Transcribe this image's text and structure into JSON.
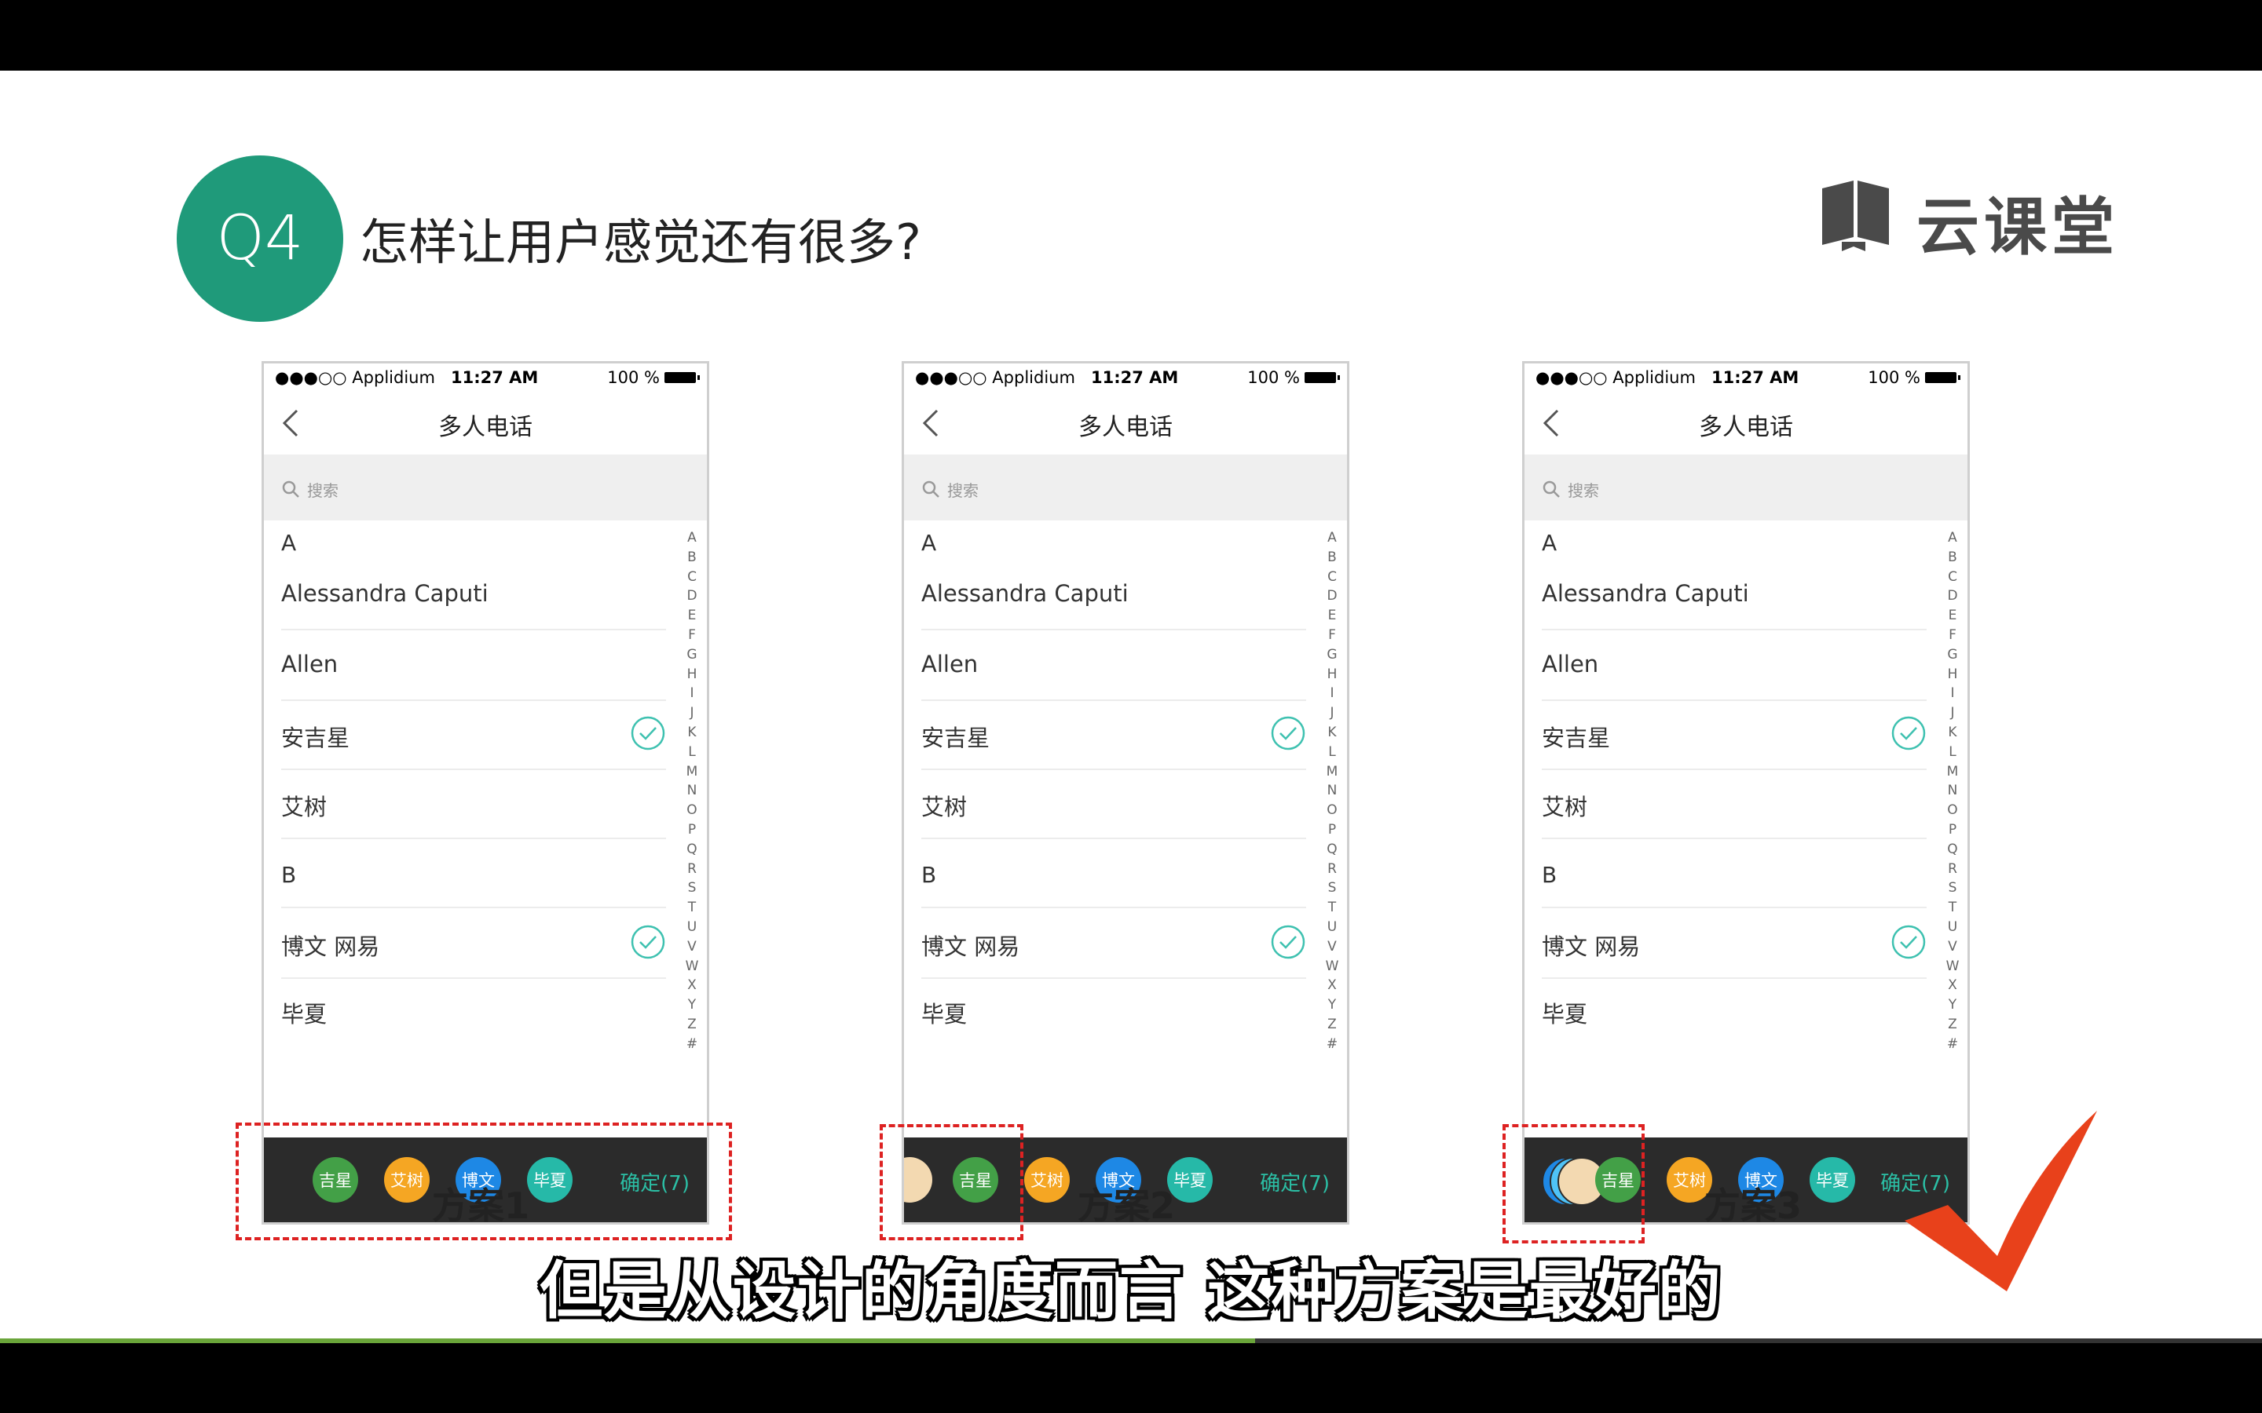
{
  "header": {
    "badge": "Q4",
    "title": "怎样让用户感觉还有很多?"
  },
  "logo": {
    "text": "云课堂"
  },
  "phone": {
    "status": {
      "carrier": "●●●○○ Applidium",
      "time": "11:27 AM",
      "battery": "100 %"
    },
    "nav_title": "多人电话",
    "search_placeholder": "搜索",
    "section_a": "A",
    "section_b": "B",
    "contacts": [
      {
        "name": "Alessandra Caputi",
        "checked": false
      },
      {
        "name": "Allen",
        "checked": false
      },
      {
        "name": "安吉星",
        "checked": true
      },
      {
        "name": "艾树",
        "checked": false
      },
      {
        "name": "博文 网易",
        "checked": true
      },
      {
        "name": "毕夏",
        "checked": false
      }
    ],
    "index_letters": "A B C D E F G H I J K L M N O P Q R S T U V W X Y Z #",
    "chips": [
      "吉星",
      "艾树",
      "博文",
      "毕夏"
    ],
    "confirm": "确定(7)"
  },
  "captions": [
    "方案1",
    "方案2",
    "方案3"
  ],
  "subtitle": "但是从设计的角度而言 这种方案是最好的",
  "colors": {
    "badge": "#1f9a7a",
    "chip_green": "#43a047",
    "chip_orange": "#f5a623",
    "chip_blue": "#1e88e5",
    "chip_teal": "#26b9a8",
    "check": "#3ec1b0",
    "dash": "#dd2222",
    "checkmark": "#e8411b"
  },
  "video": {
    "progress_fraction": 0.555
  }
}
